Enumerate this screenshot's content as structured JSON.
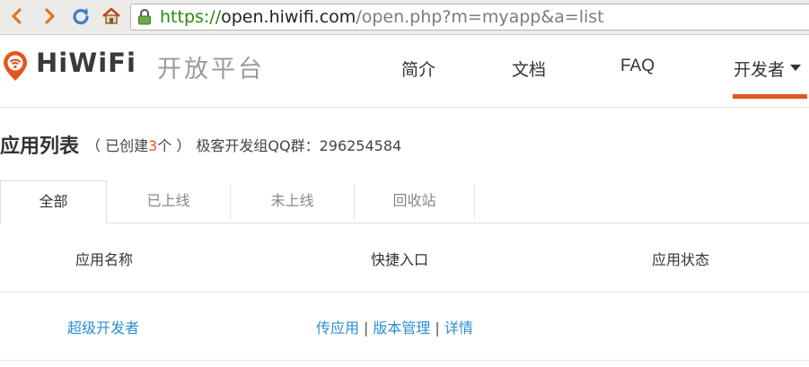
{
  "browser": {
    "url_scheme": "https://",
    "url_host": "open.hiwifi.com",
    "url_path": "/open.php?m=myapp&a=list"
  },
  "header": {
    "logo_text": "HiWiFi",
    "logo_subtitle": "开放平台",
    "nav": [
      {
        "label": "简介"
      },
      {
        "label": "文档"
      },
      {
        "label": "FAQ"
      },
      {
        "label": "开发者"
      }
    ],
    "accent_color": "#e2571e"
  },
  "page": {
    "title": "应用列表",
    "meta_open": "（ 已创建",
    "app_count": "3",
    "meta_unit": "个 ）",
    "qq_group": "极客开发组QQ群：296254584"
  },
  "tabs": [
    {
      "label": "全部",
      "active": true
    },
    {
      "label": "已上线",
      "active": false
    },
    {
      "label": "未上线",
      "active": false
    },
    {
      "label": "回收站",
      "active": false
    }
  ],
  "table": {
    "columns": [
      "应用名称",
      "快捷入口",
      "应用状态"
    ],
    "rows": [
      {
        "name": "超级开发者",
        "actions": [
          "传应用",
          "版本管理",
          "详情"
        ],
        "separator": "|",
        "status": ""
      }
    ]
  }
}
